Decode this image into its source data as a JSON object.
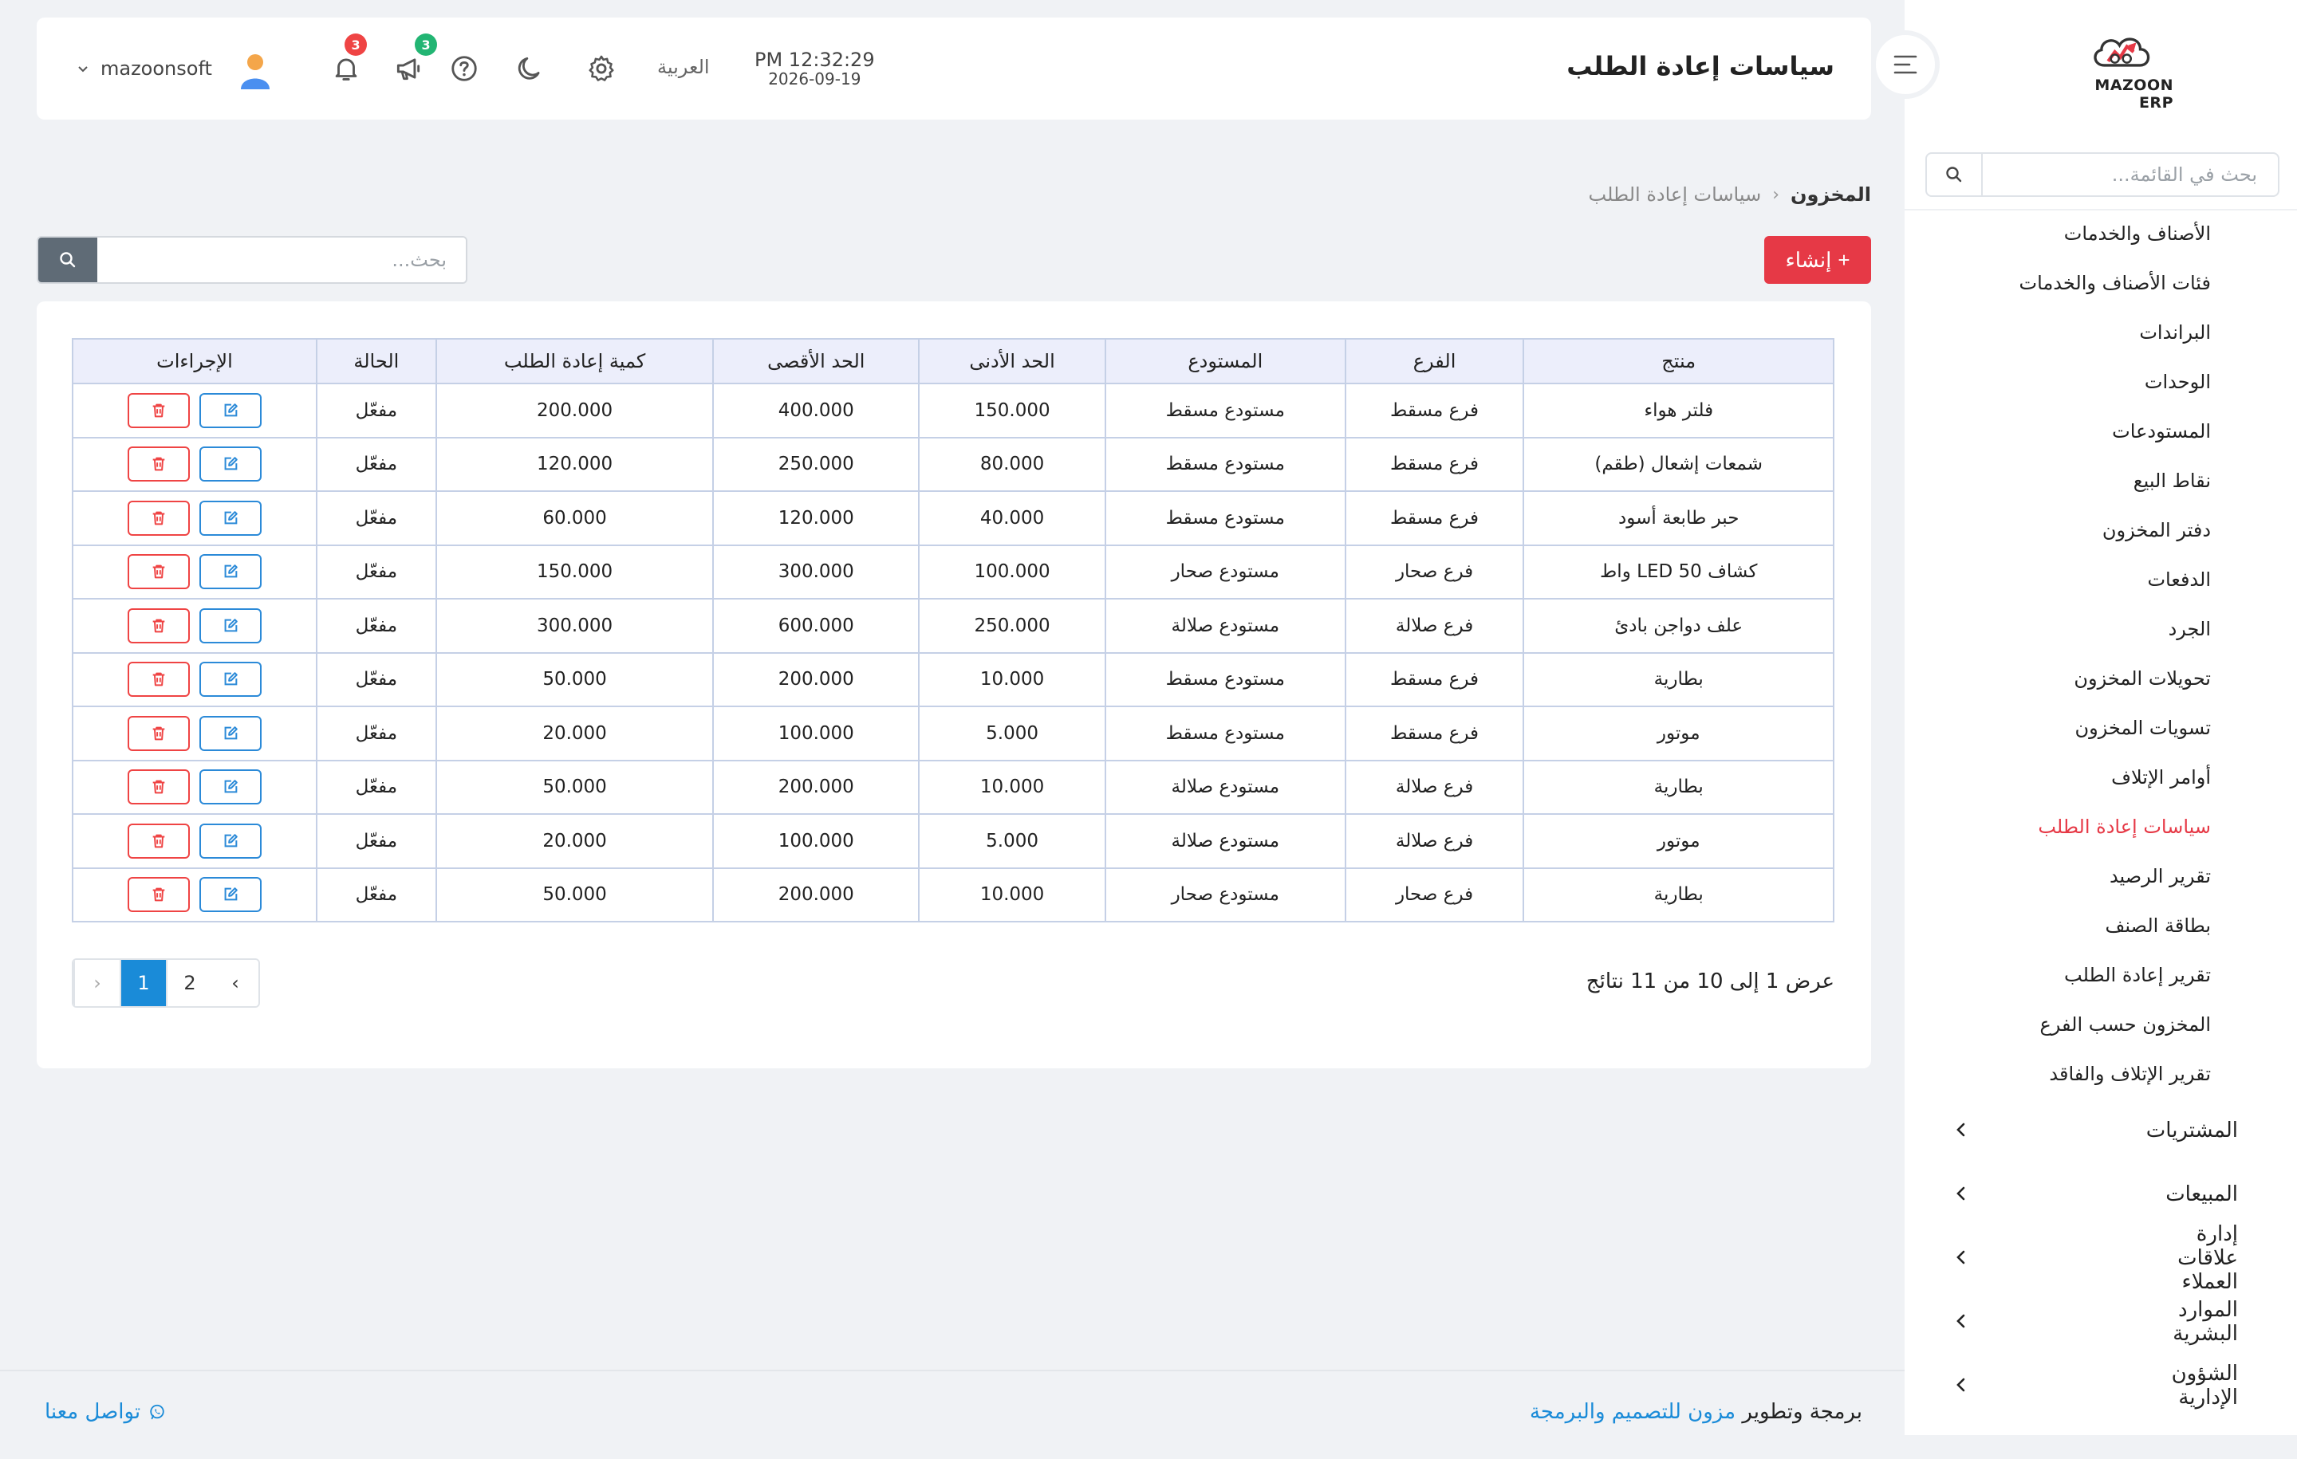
{
  "header": {
    "title": "سياسات إعادة الطلب",
    "time": "PM 12:32:29",
    "date": "2026-09-19",
    "language": "العربية",
    "notifications_count": "3",
    "announcements_count": "3",
    "username": "mazoonsoft"
  },
  "sidebar": {
    "logo_text": "MAZOON ERP",
    "search_placeholder": "بحث في القائمة...",
    "items": [
      {
        "label": "الأصناف والخدمات"
      },
      {
        "label": "فئات الأصناف والخدمات"
      },
      {
        "label": "البراندات"
      },
      {
        "label": "الوحدات"
      },
      {
        "label": "المستودعات"
      },
      {
        "label": "نقاط البيع"
      },
      {
        "label": "دفتر المخزون"
      },
      {
        "label": "الدفعات"
      },
      {
        "label": "الجرد"
      },
      {
        "label": "تحويلات المخزون"
      },
      {
        "label": "تسويات المخزون"
      },
      {
        "label": "أوامر الإتلاف"
      },
      {
        "label": "سياسات إعادة الطلب"
      },
      {
        "label": "تقرير الرصيد"
      },
      {
        "label": "بطاقة الصنف"
      },
      {
        "label": "تقرير إعادة الطلب"
      },
      {
        "label": "المخزون حسب الفرع"
      },
      {
        "label": "تقرير الإتلاف والفاقد"
      }
    ],
    "groups": [
      {
        "label": "المشتريات",
        "icon": "cart-icon"
      },
      {
        "label": "المبيعات",
        "icon": "cash-icon"
      },
      {
        "label": "إدارة علاقات العملاء",
        "icon": "contacts-icon"
      },
      {
        "label": "الموارد البشرية",
        "icon": "users-icon"
      },
      {
        "label": "الشؤون الإدارية",
        "icon": "briefcase-icon"
      }
    ]
  },
  "breadcrumb": {
    "root": "المخزون",
    "separator": "‹",
    "current": "سياسات إعادة الطلب"
  },
  "toolbar": {
    "create_label": "إنشاء",
    "search_placeholder": "بحث..."
  },
  "table": {
    "columns": {
      "product": "منتج",
      "branch": "الفرع",
      "warehouse": "المستودع",
      "min": "الحد الأدنى",
      "max": "الحد الأقصى",
      "reorder_qty": "كمية إعادة الطلب",
      "status": "الحالة",
      "actions": "الإجراءات"
    },
    "rows": [
      {
        "product": "فلتر هواء",
        "branch": "فرع مسقط",
        "warehouse": "مستودع مسقط",
        "min": "150.000",
        "max": "400.000",
        "reorder_qty": "200.000",
        "status": "مفعّل"
      },
      {
        "product": "شمعات إشعال (طقم)",
        "branch": "فرع مسقط",
        "warehouse": "مستودع مسقط",
        "min": "80.000",
        "max": "250.000",
        "reorder_qty": "120.000",
        "status": "مفعّل"
      },
      {
        "product": "حبر طابعة أسود",
        "branch": "فرع مسقط",
        "warehouse": "مستودع مسقط",
        "min": "40.000",
        "max": "120.000",
        "reorder_qty": "60.000",
        "status": "مفعّل"
      },
      {
        "product": "كشاف LED 50 واط",
        "branch": "فرع صحار",
        "warehouse": "مستودع صحار",
        "min": "100.000",
        "max": "300.000",
        "reorder_qty": "150.000",
        "status": "مفعّل"
      },
      {
        "product": "علف دواجن بادئ",
        "branch": "فرع صلالة",
        "warehouse": "مستودع صلالة",
        "min": "250.000",
        "max": "600.000",
        "reorder_qty": "300.000",
        "status": "مفعّل"
      },
      {
        "product": "بطارية",
        "branch": "فرع مسقط",
        "warehouse": "مستودع مسقط",
        "min": "10.000",
        "max": "200.000",
        "reorder_qty": "50.000",
        "status": "مفعّل"
      },
      {
        "product": "موتور",
        "branch": "فرع مسقط",
        "warehouse": "مستودع مسقط",
        "min": "5.000",
        "max": "100.000",
        "reorder_qty": "20.000",
        "status": "مفعّل"
      },
      {
        "product": "بطارية",
        "branch": "فرع صلالة",
        "warehouse": "مستودع صلالة",
        "min": "10.000",
        "max": "200.000",
        "reorder_qty": "50.000",
        "status": "مفعّل"
      },
      {
        "product": "موتور",
        "branch": "فرع صلالة",
        "warehouse": "مستودع صلالة",
        "min": "5.000",
        "max": "100.000",
        "reorder_qty": "20.000",
        "status": "مفعّل"
      },
      {
        "product": "بطارية",
        "branch": "فرع صحار",
        "warehouse": "مستودع صحار",
        "min": "10.000",
        "max": "200.000",
        "reorder_qty": "50.000",
        "status": "مفعّل"
      }
    ]
  },
  "pagination": {
    "summary": "عرض 1 إلى 10 من 11 نتائج",
    "prev": "‹",
    "next": "›",
    "pages": [
      "1",
      "2"
    ],
    "current": "1"
  },
  "footer": {
    "credit_prefix": "برمجة وتطوير",
    "credit_link": "مزون للتصميم والبرمجة",
    "contact": "تواصل معنا"
  },
  "colors": {
    "accent_red": "#e63946",
    "link_blue": "#1a8bd8",
    "table_header_bg": "#eceefb"
  }
}
